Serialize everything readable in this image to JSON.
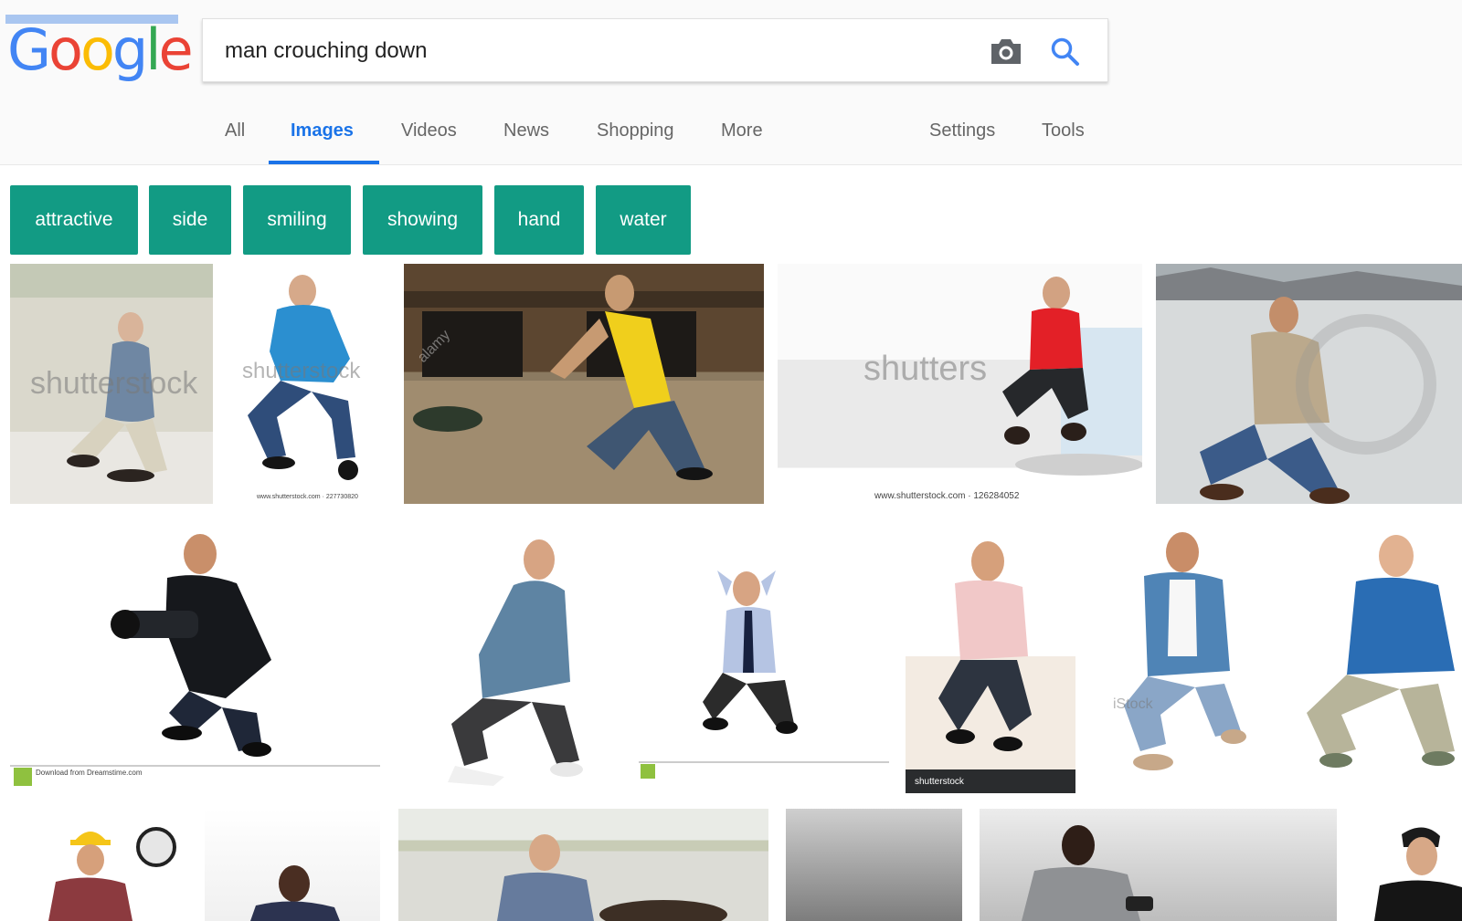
{
  "logo": {
    "letters": [
      "G",
      "o",
      "o",
      "g",
      "l",
      "e"
    ],
    "colors": [
      "#4285f4",
      "#ea4335",
      "#fbbc05",
      "#4285f4",
      "#34a853",
      "#ea4335"
    ]
  },
  "search": {
    "query": "man crouching down",
    "camera_icon": "camera-icon",
    "search_icon": "search-icon"
  },
  "tabs": {
    "all": "All",
    "images": "Images",
    "videos": "Videos",
    "news": "News",
    "shopping": "Shopping",
    "more": "More",
    "settings": "Settings",
    "tools": "Tools"
  },
  "chips": [
    "attractive",
    "side",
    "smiling",
    "showing",
    "hand",
    "water"
  ],
  "watermarks": {
    "shutterstock": "shutterstock",
    "shutterstock_short": "shutters",
    "alamy": "alamy",
    "istock": "iStock",
    "shutterstock_bar": "shutterstock"
  },
  "captions": {
    "tile2": "www.shutterstock.com · 227730820",
    "tile4": "www.shutterstock.com · 126284052",
    "dreamstime": "Download from Dreamstime.com"
  },
  "colors": {
    "accent": "#1a73e8",
    "chip": "#129b84"
  }
}
